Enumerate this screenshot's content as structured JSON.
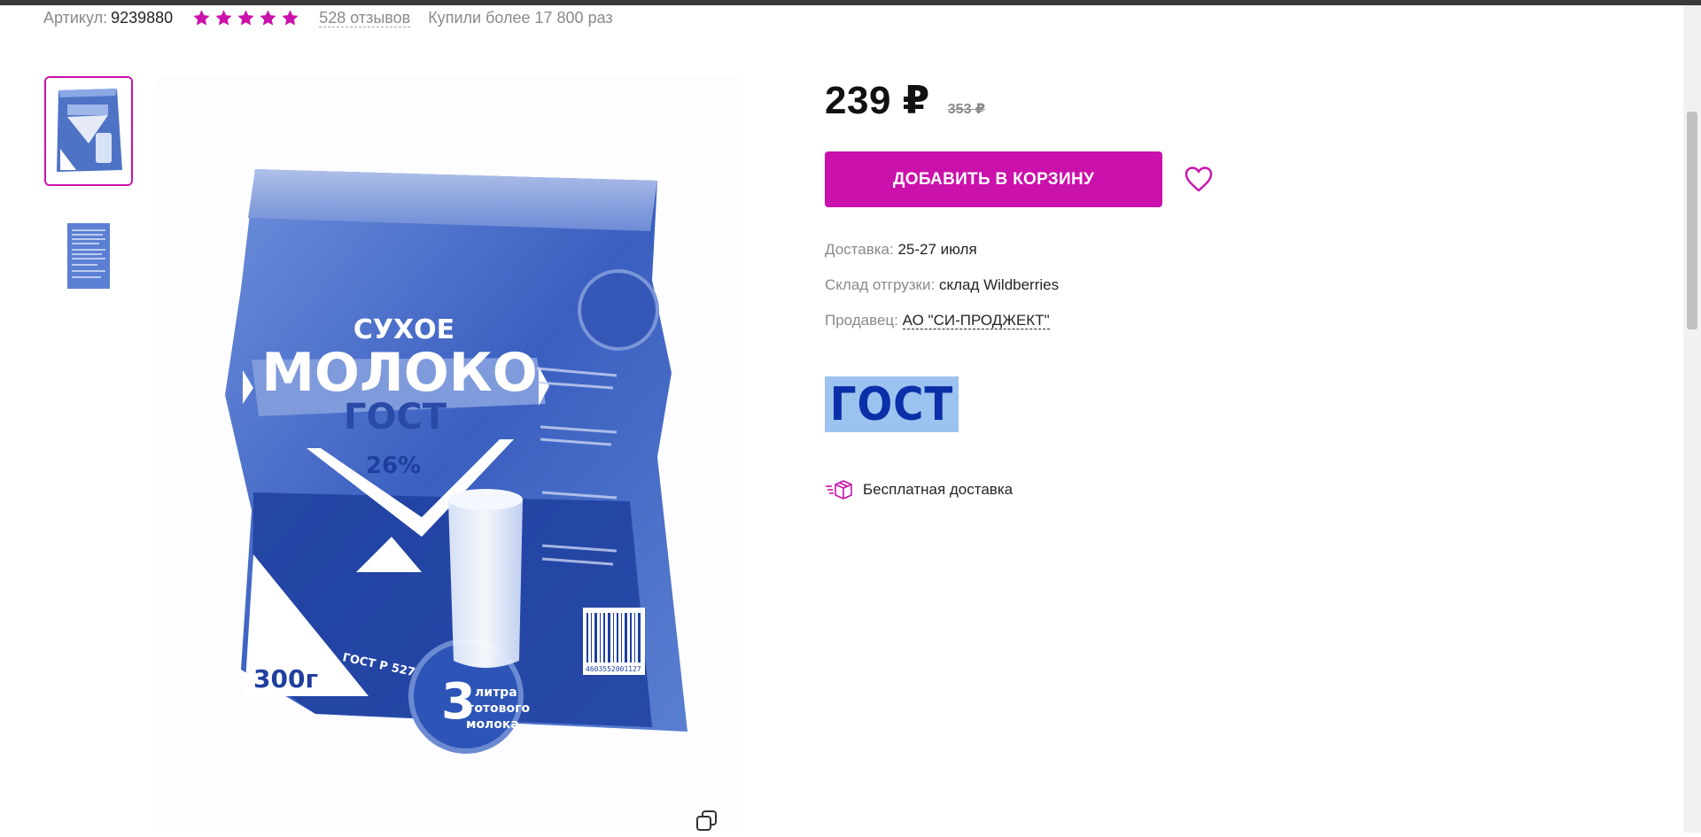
{
  "meta": {
    "article_label": "Артикул:",
    "article_value": "9239880",
    "rating_stars": 5,
    "reviews_link": "528 отзывов",
    "bought_text": "Купили более 17 800 раз"
  },
  "product": {
    "price": "239 ₽",
    "old_price": "353 ₽",
    "add_to_cart_label": "ДОБАВИТЬ В КОРЗИНУ",
    "package_text": {
      "line1": "СУХОЕ",
      "line2": "МОЛОКО",
      "line3": "ГОСТ",
      "fat": "26%",
      "weight": "300г",
      "standard": "ГОСТ Р 52791-2007",
      "liters_num": "3",
      "liters_text1": "литра",
      "liters_text2": "готового",
      "liters_text3": "молока",
      "barcode": "4603552001127"
    }
  },
  "details": {
    "delivery_label": "Доставка:",
    "delivery_value": "25-27 июля",
    "warehouse_label": "Склад отгрузки:",
    "warehouse_value": "склад Wildberries",
    "seller_label": "Продавец:",
    "seller_value": "АО \"СИ-ПРОДЖЕКТ\""
  },
  "badge": {
    "gost_text": "ГОСТ"
  },
  "shipping": {
    "free_label": "Бесплатная доставка"
  },
  "colors": {
    "accent": "#cb11ab",
    "package_blue": "#1d3f9e",
    "badge_bg": "#9cc3ef"
  }
}
